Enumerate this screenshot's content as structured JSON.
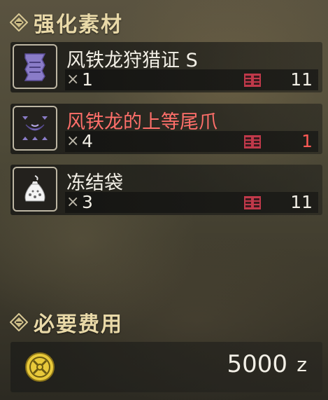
{
  "materials_header": {
    "title": "强化素材"
  },
  "materials": [
    {
      "name": "风铁龙狩猎证 S",
      "qty_prefix": "×",
      "qty": "1",
      "stock": "11",
      "insufficient": false,
      "icon": "hunting-certificate-icon",
      "color": "#8a7cc8"
    },
    {
      "name": "风铁龙的上等尾爪",
      "qty_prefix": "×",
      "qty": "4",
      "stock": "1",
      "insufficient": true,
      "icon": "tail-claw-icon",
      "color": "#8a7cc8"
    },
    {
      "name": "冻结袋",
      "qty_prefix": "×",
      "qty": "3",
      "stock": "11",
      "insufficient": false,
      "icon": "freeze-sac-icon",
      "color": "#ffffff"
    }
  ],
  "cost_header": {
    "title": "必要费用"
  },
  "cost": {
    "amount": "5000",
    "unit": "z",
    "icon": "zenny-coin-icon"
  },
  "colors": {
    "header_text": "#e9d9a8",
    "insufficient_text": "#ff6f6a",
    "box_icon": "#c0394a"
  }
}
